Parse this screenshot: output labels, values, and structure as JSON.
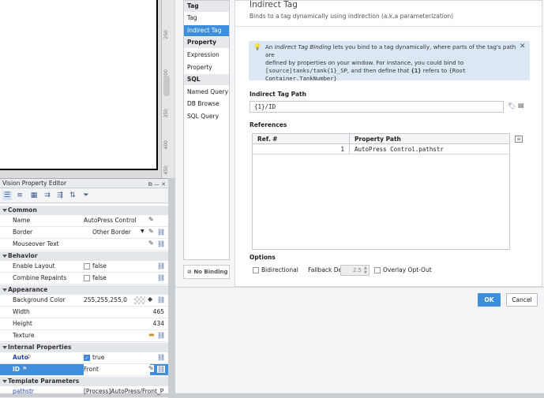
{
  "canvas": {
    "ruler_marks": [
      "250",
      "300",
      "350",
      "400",
      "450"
    ]
  },
  "property_editor": {
    "title": "Vision Property Editor",
    "sections": {
      "common": "Common",
      "behavior": "Behavior",
      "appearance": "Appearance",
      "internal": "Internal Properties",
      "template": "Template Parameters"
    },
    "rows": {
      "name": {
        "label": "Name",
        "value": "AutoPress Control"
      },
      "border": {
        "label": "Border",
        "value": "Other Border"
      },
      "mouseover": {
        "label": "Mouseover Text",
        "value": ""
      },
      "enable_layout": {
        "label": "Enable Layout",
        "value": "false"
      },
      "combine_repaints": {
        "label": "Combine Repaints",
        "value": "false"
      },
      "background": {
        "label": "Background Color",
        "value": "255,255,255,0"
      },
      "width": {
        "label": "Width",
        "value": "465"
      },
      "height": {
        "label": "Height",
        "value": "434"
      },
      "texture": {
        "label": "Texture",
        "value": ""
      },
      "auto": {
        "label": "Auto",
        "value": "true"
      },
      "id": {
        "label": "ID",
        "value": "Front"
      },
      "pathstr": {
        "label": "pathstr",
        "value": "[Process]AutoPress/Front_P"
      }
    }
  },
  "binding_types": {
    "tag_header": "Tag",
    "tag": "Tag",
    "indirect_tag": "Indirect Tag",
    "property_header": "Property",
    "expression": "Expression",
    "property": "Property",
    "sql_header": "SQL",
    "named_query": "Named Query",
    "db_browse": "DB Browse",
    "sql_query": "SQL Query",
    "no_binding": "No Binding"
  },
  "panel": {
    "title": "Indirect Tag",
    "subtitle": "Binds to a tag dynamically using indirection (a.k.a parameterization)",
    "info_line1_a": "An ",
    "info_line1_em": "Indirect Tag Binding",
    "info_line1_b": " lets you bind to a tag dynamically, where parts of the tag's path are",
    "info_line2": "defined by properties on your window. For instance, you could bind to",
    "info_line3_code": "[source]tanks/tank{1}_SP",
    "info_line3_b": ", and then define that ",
    "info_line3_code2": "{1}",
    "info_line3_c": " refers to ",
    "info_line3_code3": "{Root",
    "info_line4_code": "Container.TankNumber}",
    "indirect_path_label": "Indirect Tag Path",
    "indirect_path_value": "{1}/ID",
    "references_label": "References",
    "col_ref": "Ref. #",
    "col_path": "Property Path",
    "ref_num": "1",
    "ref_path": "AutoPress Control.pathstr",
    "options_label": "Options",
    "bidirectional": "Bidirectional",
    "fallback_label": "Fallback Delay",
    "fallback_value": "2.5",
    "overlay": "Overlay Opt-Out"
  },
  "buttons": {
    "ok": "OK",
    "cancel": "Cancel"
  }
}
